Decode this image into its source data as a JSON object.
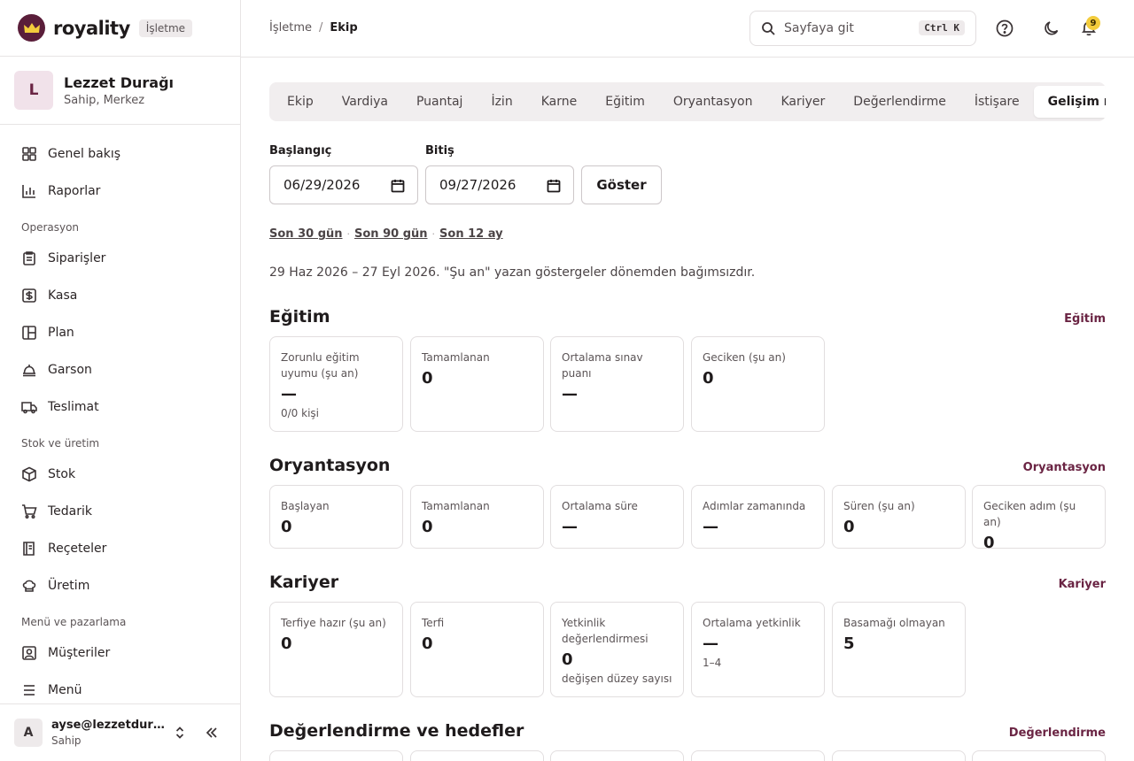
{
  "brand": {
    "name": "royality",
    "badge": "İşletme"
  },
  "org": {
    "initial": "L",
    "name": "Lezzet Durağı",
    "role": "Sahip, Merkez"
  },
  "nav": {
    "top": [
      {
        "label": "Genel bakış",
        "icon": "dashboard-icon"
      },
      {
        "label": "Raporlar",
        "icon": "chart-icon"
      }
    ],
    "operasyon_title": "Operasyon",
    "operasyon": [
      {
        "label": "Siparişler",
        "icon": "clipboard-icon"
      },
      {
        "label": "Kasa",
        "icon": "dollar-icon"
      },
      {
        "label": "Plan",
        "icon": "layout-icon"
      },
      {
        "label": "Garson",
        "icon": "serving-bell-icon"
      },
      {
        "label": "Teslimat",
        "icon": "truck-icon"
      }
    ],
    "stok_title": "Stok ve üretim",
    "stok": [
      {
        "label": "Stok",
        "icon": "box-icon"
      },
      {
        "label": "Tedarik",
        "icon": "cart-icon"
      },
      {
        "label": "Reçeteler",
        "icon": "book-icon"
      },
      {
        "label": "Üretim",
        "icon": "chef-hat-icon"
      }
    ],
    "menu_title": "Menü ve pazarlama",
    "menu": [
      {
        "label": "Müşteriler",
        "icon": "contact-icon"
      },
      {
        "label": "Menü",
        "icon": "menu-icon"
      }
    ]
  },
  "user": {
    "initial": "A",
    "email": "ayse@lezzetduragi.com",
    "role": "Sahip"
  },
  "breadcrumb": {
    "parent": "İşletme",
    "separator": "/",
    "current": "Ekip"
  },
  "search": {
    "placeholder": "Sayfaya git",
    "shortcut": "Ctrl K"
  },
  "notifications": {
    "count": "9"
  },
  "tabs": [
    {
      "label": "Ekip"
    },
    {
      "label": "Vardiya"
    },
    {
      "label": "Puantaj"
    },
    {
      "label": "İzin"
    },
    {
      "label": "Karne"
    },
    {
      "label": "Eğitim"
    },
    {
      "label": "Oryantasyon"
    },
    {
      "label": "Kariyer"
    },
    {
      "label": "Değerlendirme"
    },
    {
      "label": "İstişare"
    },
    {
      "label": "Gelişim raporu",
      "active": true
    }
  ],
  "filters": {
    "start_label": "Başlangıç",
    "start_value": "06/29/2026",
    "end_label": "Bitiş",
    "end_value": "09/27/2026",
    "show_button": "Göster",
    "quick": [
      "Son 30 gün",
      "Son 90 gün",
      "Son 12 ay"
    ],
    "range_note": "29 Haz 2026 – 27 Eyl 2026. \"Şu an\" yazan göstergeler dönemden bağımsızdır."
  },
  "sections": {
    "egitim": {
      "title": "Eğitim",
      "link": "Eğitim",
      "cards": [
        {
          "label": "Zorunlu eğitim uyumu (şu an)",
          "value": "—",
          "sub": "0/0 kişi"
        },
        {
          "label": "Tamamlanan",
          "value": "0"
        },
        {
          "label": "Ortalama sınav puanı",
          "value": "—"
        },
        {
          "label": "Geciken (şu an)",
          "value": "0"
        }
      ]
    },
    "oryantasyon": {
      "title": "Oryantasyon",
      "link": "Oryantasyon",
      "cards": [
        {
          "label": "Başlayan",
          "value": "0"
        },
        {
          "label": "Tamamlanan",
          "value": "0"
        },
        {
          "label": "Ortalama süre",
          "value": "—"
        },
        {
          "label": "Adımlar zamanında",
          "value": "—"
        },
        {
          "label": "Süren (şu an)",
          "value": "0"
        },
        {
          "label": "Geciken adım (şu an)",
          "value": "0"
        }
      ]
    },
    "kariyer": {
      "title": "Kariyer",
      "link": "Kariyer",
      "cards": [
        {
          "label": "Terfiye hazır (şu an)",
          "value": "0"
        },
        {
          "label": "Terfi",
          "value": "0"
        },
        {
          "label": "Yetkinlik değerlendirmesi",
          "value": "0",
          "sub": "değişen düzey sayısı"
        },
        {
          "label": "Ortalama yetkinlik",
          "value": "—",
          "sub": "1–4"
        },
        {
          "label": "Basamağı olmayan",
          "value": "5"
        }
      ]
    },
    "degerlendirme": {
      "title": "Değerlendirme ve hedefler",
      "link": "Değerlendirme"
    }
  },
  "colors": {
    "accent": "#6a2443",
    "badge": "#f3cc3c"
  }
}
